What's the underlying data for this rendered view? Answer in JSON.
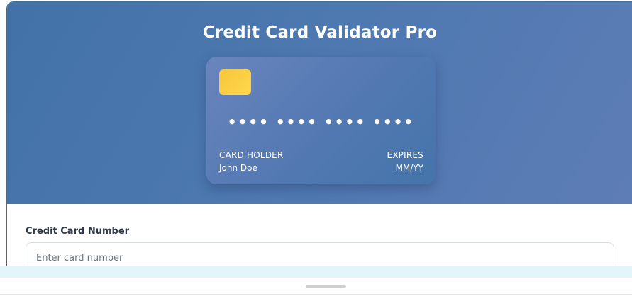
{
  "app": {
    "title": "Credit Card Validator Pro"
  },
  "card_preview": {
    "number": "•••• •••• •••• ••••",
    "holder_label": "CARD HOLDER",
    "holder_name": "John Doe",
    "expires_label": "EXPIRES",
    "expires_value": "MM/YY"
  },
  "form": {
    "card_number_label": "Credit Card Number",
    "card_number_placeholder": "Enter card number",
    "card_number_value": ""
  },
  "colors": {
    "header_accent": "#4d78b0",
    "chip": "#ffd04a"
  }
}
